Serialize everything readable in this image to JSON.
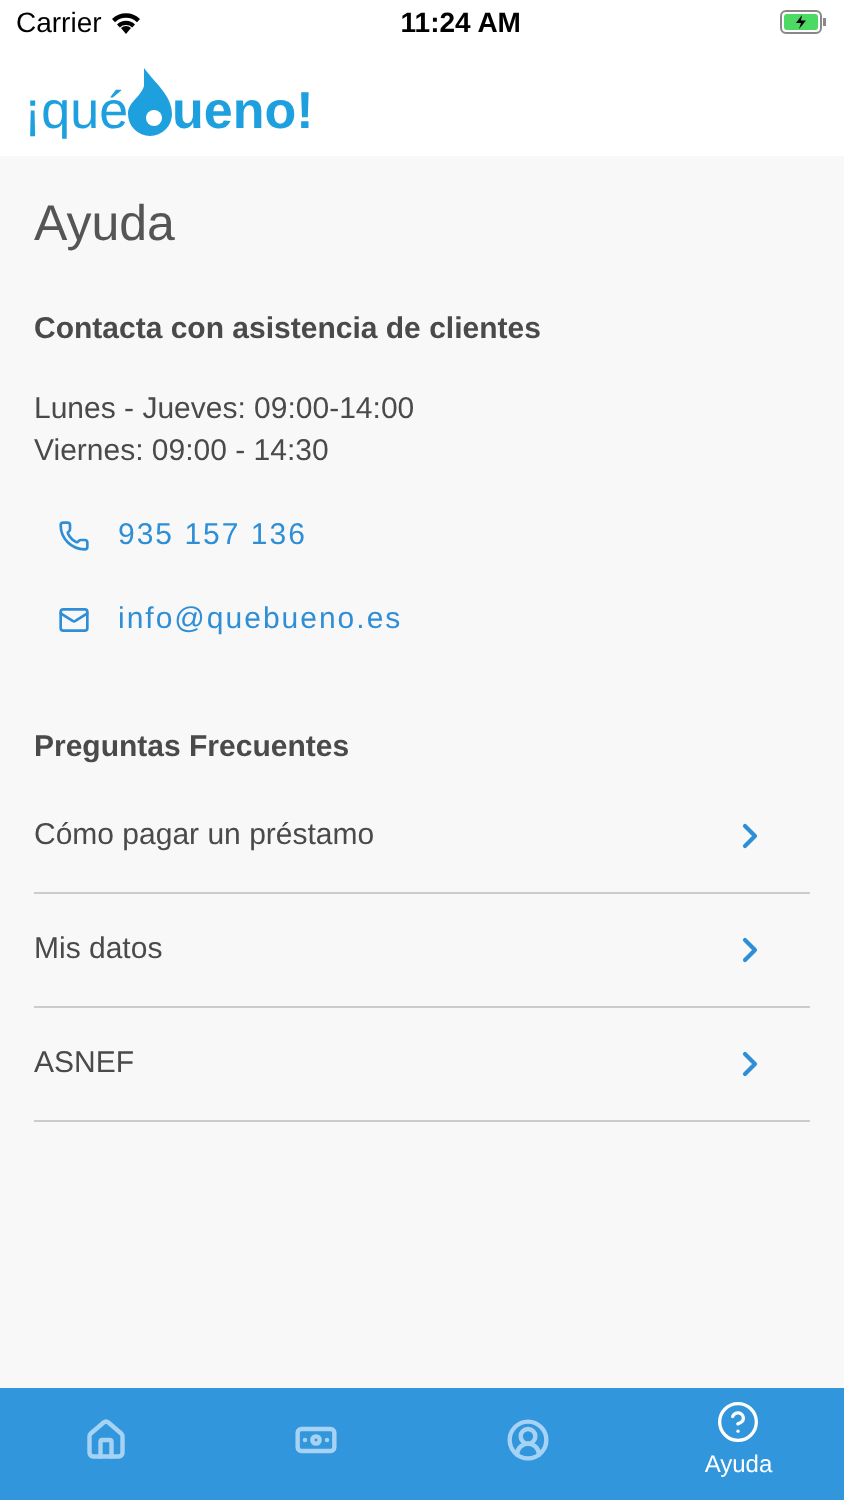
{
  "status_bar": {
    "carrier": "Carrier",
    "time": "11:24 AM"
  },
  "logo": {
    "before": "¡qué",
    "after": "ueno!"
  },
  "title": "Ayuda",
  "contact": {
    "heading": "Contacta con asistencia de clientes",
    "hours": [
      "Lunes - Jueves: 09:00-14:00",
      "Viernes: 09:00 - 14:30"
    ],
    "links": [
      {
        "kind": "phone",
        "text": "935 157 136"
      },
      {
        "kind": "email",
        "text": "info@quebueno.es"
      }
    ]
  },
  "faq": {
    "heading": "Preguntas Frecuentes",
    "items": [
      "Cómo pagar un préstamo",
      "Mis datos",
      "ASNEF"
    ]
  },
  "tabs": [
    {
      "kind": "home",
      "selected": false
    },
    {
      "kind": "money",
      "selected": false
    },
    {
      "kind": "profile",
      "selected": false
    },
    {
      "kind": "help",
      "label": "Ayuda",
      "selected": true
    }
  ]
}
